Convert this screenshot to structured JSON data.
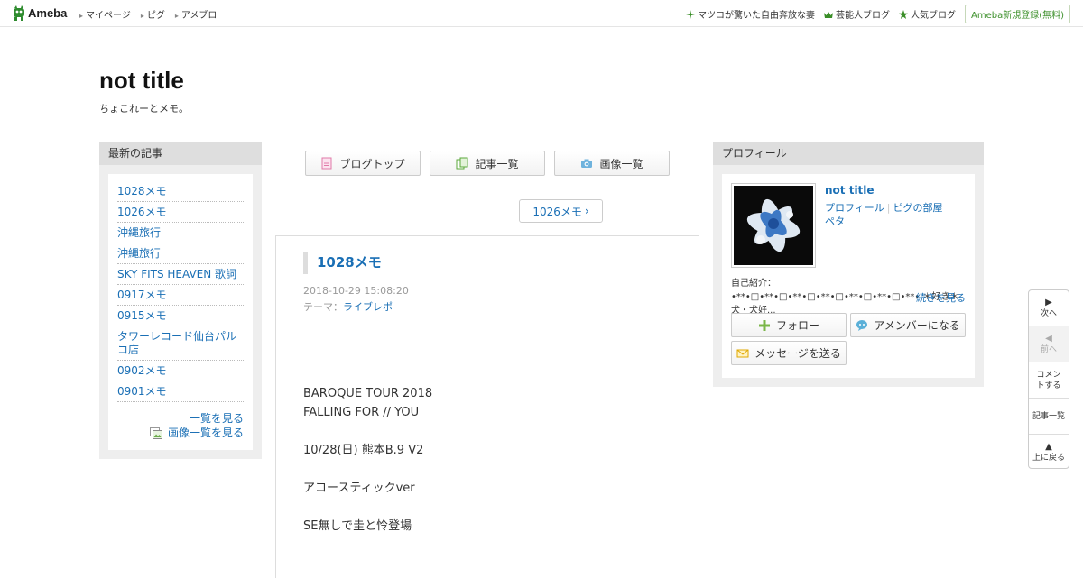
{
  "header": {
    "logo": "Ameba",
    "nav": [
      "マイページ",
      "ピグ",
      "アメブロ"
    ],
    "right_links": [
      "マツコが驚いた自由奔放な妻",
      "芸能人ブログ",
      "人気ブログ"
    ],
    "signup": "Ameba新規登録(無料)"
  },
  "blog": {
    "title": "not title",
    "description": "ちょこれーとメモ。"
  },
  "sidebar_left": {
    "heading": "最新の記事",
    "items": [
      "1028メモ",
      "1026メモ",
      "沖縄旅行",
      "沖縄旅行",
      "SKY FITS HEAVEN 歌詞",
      "0917メモ",
      "0915メモ",
      "タワーレコード仙台パルコ店",
      "0902メモ",
      "0901メモ"
    ],
    "more": "一覧を見る",
    "images": "画像一覧を見る"
  },
  "nav_buttons": {
    "top": "ブログトップ",
    "list": "記事一覧",
    "images": "画像一覧"
  },
  "pager": {
    "next": "1026メモ"
  },
  "article": {
    "title": "1028メモ",
    "date": "2018-10-29 15:08:20",
    "theme_label": "テーマ：",
    "theme": "ライブレポ",
    "body": [
      "BAROQUE TOUR 2018",
      "FALLING FOR // YOU",
      "",
      "10/28(日) 熊本B.9 V2",
      "",
      "アコースティックver",
      "",
      "SE無しで圭と怜登場"
    ]
  },
  "profile": {
    "heading": "プロフィール",
    "name": "not title",
    "link_profile": "プロフィール",
    "link_room": "ピグの部屋",
    "link_peta": "ペタ",
    "intro": "自己紹介：  •**•□•**•□•**•□•**•□•**•□•**•□•**•  ＊好き＊ 犬・犬好...",
    "more": "続きを見る",
    "follow": "フォロー",
    "member": "アメンバーになる",
    "message": "メッセージを送る"
  },
  "float_nav": {
    "next": "次へ",
    "prev": "前へ",
    "comment": "コメントする",
    "list": "記事一覧",
    "top": "上に戻る"
  },
  "colors": {
    "link": "#1a6fb5",
    "accent_green": "#3a8e28"
  }
}
